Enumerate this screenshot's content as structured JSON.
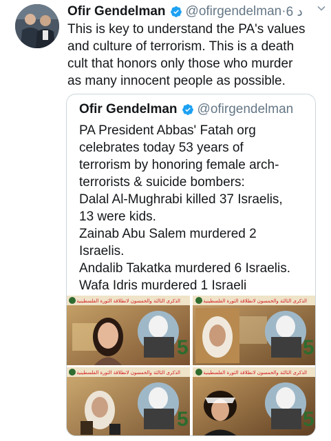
{
  "tweet": {
    "author_name": "Ofir Gendelman",
    "author_handle": "@ofirgendelman",
    "separator": " · ",
    "time": "6 د",
    "text_lines": [
      "This is key to understand the PA's values",
      "and culture of terrorism. This is a death",
      "cult that honors only those who murder",
      "as many innocent people as possible."
    ]
  },
  "quoted_tweet": {
    "author_name": "Ofir Gendelman",
    "author_handle": "@ofirgendelman",
    "text_lines": [
      "PA President Abbas' Fatah org",
      "celebrates today 53 years of",
      "terrorism by honoring female arch-",
      "terrorists & suicide bombers:",
      "Dalal Al-Mughrabi killed 37 Israelis,",
      "13 were kids.",
      "Zainab Abu Salem murdered 2",
      "Israelis.",
      "Andalib Takatka murdered 6 Israelis.",
      "Wafa Idris murdered 1 Israeli"
    ],
    "media": [
      {
        "banner": "الذكرى الثالثة والخمسون لانطلاقة الثورة الفلسطينية"
      },
      {
        "banner": "الذكرى الثالثة والخمسون لانطلاقة الثورة الفلسطينية"
      },
      {
        "banner": "الذكرى الثالثة والخمسون لانطلاقة الثورة الفلسطينية"
      },
      {
        "banner": "الذكرى الثالثة والخمسون لانطلاقة الثورة الفلسطينية"
      }
    ]
  },
  "colors": {
    "text": "#14171a",
    "secondary": "#657786",
    "verified": "#1da1f2",
    "border": "#ccd6dd"
  },
  "icons": {
    "verified": "verified-badge-icon",
    "caret": "chevron-down-icon"
  }
}
